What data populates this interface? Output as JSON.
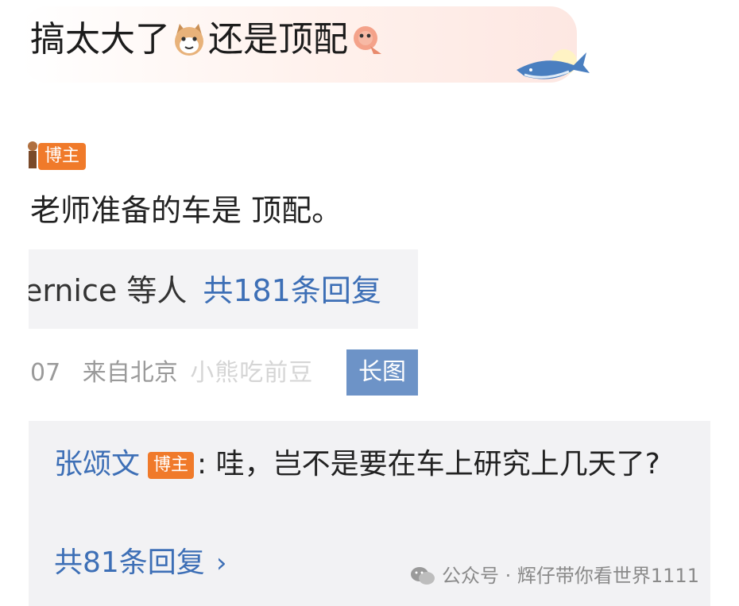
{
  "top_bubble": {
    "text_a": "搞太大了",
    "text_b": "还是顶配"
  },
  "reply": {
    "badge": "博主",
    "text": "老师准备的车是 顶配。",
    "replies_names": "ernice 等人",
    "replies_count": "共181条回复",
    "meta_time": "07",
    "meta_location": "来自北京",
    "watermark_fragment": "小熊吃前豆",
    "long_image_tag": "长图"
  },
  "comment": {
    "username": "张颂文",
    "badge": "博主",
    "text": ": 哇，岂不是要在车上研究上几天了?",
    "more_replies": "共81条回复",
    "chevron": "›"
  },
  "footer": {
    "watermark": "公众号 · 辉仔带你看世界1111"
  }
}
